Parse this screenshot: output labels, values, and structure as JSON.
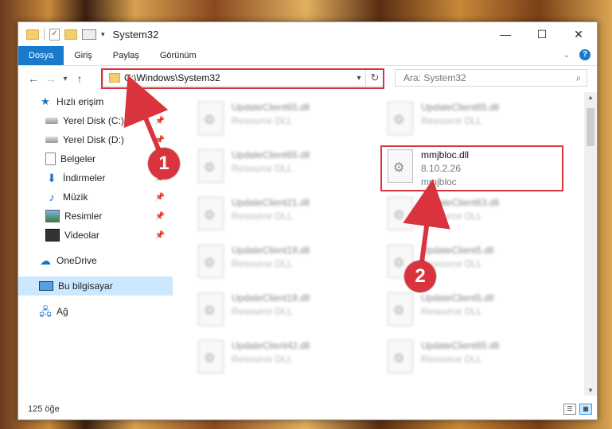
{
  "window": {
    "title": "System32"
  },
  "ribbon": {
    "tabs": [
      "Dosya",
      "Giriş",
      "Paylaş",
      "Görünüm"
    ],
    "help": "?"
  },
  "nav": {
    "back": "←",
    "forward": "→",
    "recent": "▾",
    "up": "↑"
  },
  "address": {
    "path": "C:\\Windows\\System32",
    "dropdown": "▾",
    "refresh": "↻"
  },
  "search": {
    "placeholder": "Ara: System32"
  },
  "sidebar": {
    "items": [
      {
        "label": "Hızlı erişim",
        "icon": "star-icon"
      },
      {
        "label": "Yerel Disk (C:)",
        "icon": "disk-icon",
        "pinned": true
      },
      {
        "label": "Yerel Disk (D:)",
        "icon": "disk-icon",
        "pinned": true
      },
      {
        "label": "Belgeler",
        "icon": "documents-icon",
        "pinned": true
      },
      {
        "label": "İndirmeler",
        "icon": "download-icon",
        "pinned": true
      },
      {
        "label": "Müzik",
        "icon": "music-icon",
        "pinned": true
      },
      {
        "label": "Resimler",
        "icon": "pictures-icon",
        "pinned": true
      },
      {
        "label": "Videolar",
        "icon": "videos-icon",
        "pinned": true
      },
      {
        "label": "OneDrive",
        "icon": "cloud-icon"
      },
      {
        "label": "Bu bilgisayar",
        "icon": "computer-icon",
        "selected": true
      },
      {
        "label": "Ağ",
        "icon": "network-icon"
      }
    ]
  },
  "files": {
    "left": [
      {
        "name": "UpdateClient65.dll",
        "type": "Resource DLL"
      },
      {
        "name": "UpdateClient65.dll",
        "type": "Resource DLL"
      },
      {
        "name": "UpdateClient21.dll",
        "type": "Resource DLL"
      },
      {
        "name": "UpdateClient19.dll",
        "type": "Resource DLL"
      },
      {
        "name": "UpdateClient19.dll",
        "type": "Resource DLL"
      },
      {
        "name": "UpdateClient42.dll",
        "type": "Resource DLL"
      }
    ],
    "right": [
      {
        "name": "UpdateClient65.dll",
        "type": "Resource DLL"
      },
      {
        "name": "mmjbloc.dll",
        "version": "8.10.2.26",
        "desc": "mmjbloc"
      },
      {
        "name": "UpdateClient63.dll",
        "type": "Resource DLL"
      },
      {
        "name": "UpdateClient5.dll",
        "type": "Resource DLL"
      },
      {
        "name": "UpdateClient5.dll",
        "type": "Resource DLL"
      },
      {
        "name": "UpdateClient65.dll",
        "type": "Resource DLL"
      }
    ]
  },
  "status": {
    "count": "125 öğe"
  },
  "callouts": {
    "one": "1",
    "two": "2"
  },
  "colors": {
    "accent": "#1979ca",
    "highlight": "#d9343d",
    "selection": "#cce8ff"
  }
}
